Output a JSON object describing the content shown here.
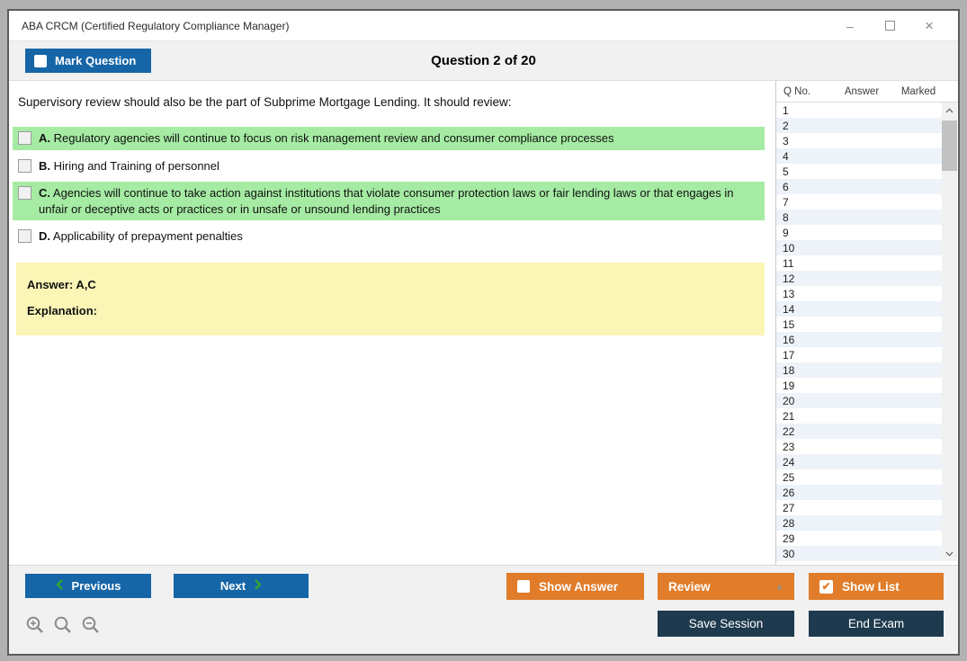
{
  "window": {
    "title": "ABA CRCM (Certified Regulatory Compliance Manager)"
  },
  "header": {
    "mark_question_label": "Mark Question",
    "question_counter": "Question 2 of 20"
  },
  "question": {
    "text": "Supervisory review should also be the part of Subprime Mortgage Lending. It should review:",
    "options": [
      {
        "letter": "A.",
        "text": "Regulatory agencies will continue to focus on risk management review and consumer compliance processes",
        "highlighted": true
      },
      {
        "letter": "B.",
        "text": "Hiring and Training of personnel",
        "highlighted": false
      },
      {
        "letter": "C.",
        "text": "Agencies will continue to take action against institutions that violate consumer protection laws or fair lending laws or that engages in unfair or deceptive acts or practices or in unsafe or unsound lending practices",
        "highlighted": true
      },
      {
        "letter": "D.",
        "text": "Applicability of prepayment penalties",
        "highlighted": false
      }
    ]
  },
  "answer_box": {
    "answer_line": "Answer: A,C",
    "explanation_line": "Explanation:"
  },
  "question_list": {
    "columns": {
      "q_no": "Q No.",
      "answer": "Answer",
      "marked": "Marked"
    },
    "rows": [
      "1",
      "2",
      "3",
      "4",
      "5",
      "6",
      "7",
      "8",
      "9",
      "10",
      "11",
      "12",
      "13",
      "14",
      "15",
      "16",
      "17",
      "18",
      "19",
      "20",
      "21",
      "22",
      "23",
      "24",
      "25",
      "26",
      "27",
      "28",
      "29",
      "30"
    ]
  },
  "footer": {
    "previous_label": "Previous",
    "next_label": "Next",
    "show_answer_label": "Show Answer",
    "review_label": "Review",
    "show_list_label": "Show List",
    "save_session_label": "Save Session",
    "end_exam_label": "End Exam"
  },
  "icons": {
    "minimize": "–",
    "close": "×",
    "review_caret_up": "▲",
    "show_list_check": "✔"
  },
  "colors": {
    "accent_blue": "#1565a7",
    "accent_orange": "#e07c2a",
    "accent_navy": "#1e3a4e",
    "option_highlight_green": "#a5eba3",
    "answer_box_yellow": "#fbf6b6",
    "row_stripe_blue": "#edf3f8",
    "chevron_green": "#2fa82f"
  }
}
